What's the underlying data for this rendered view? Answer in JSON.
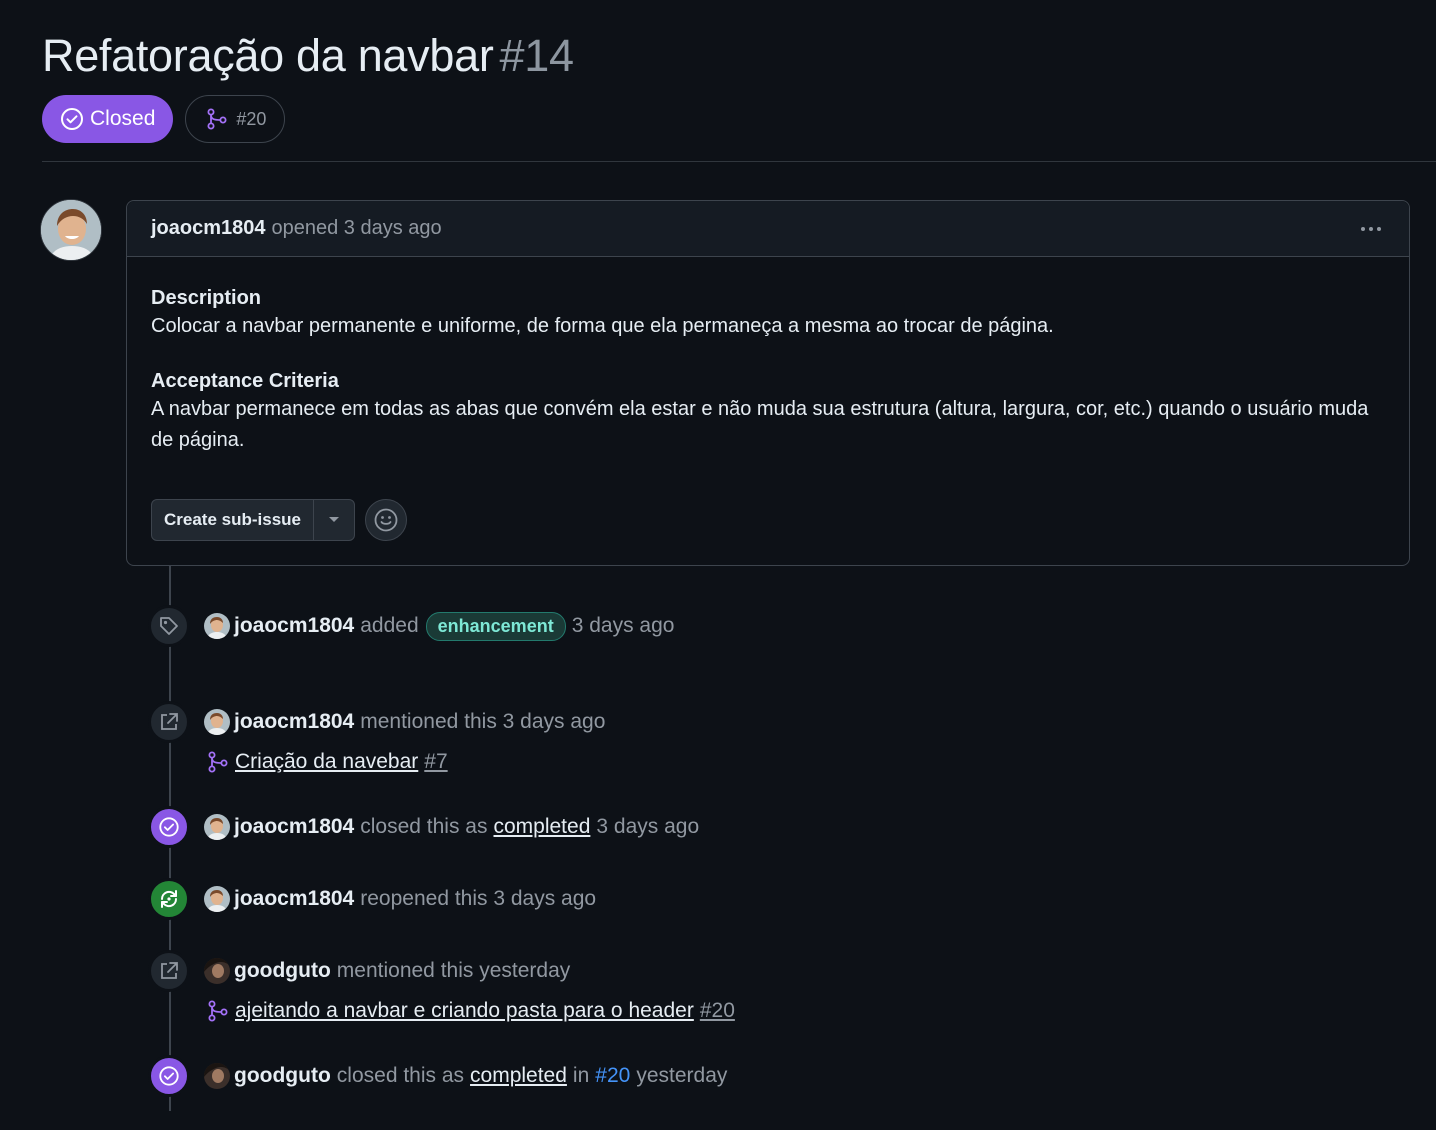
{
  "issue": {
    "title": "Refatoração da navbar",
    "number": "#14",
    "state_label": "Closed",
    "linked_pr": "#20",
    "state_color": "#8957e5"
  },
  "comment": {
    "author": "joaocm1804",
    "meta": "opened 3 days ago",
    "sections": [
      {
        "heading": "Description",
        "text": "Colocar a navbar permanente e uniforme, de forma que ela permaneça a mesma ao trocar de página."
      },
      {
        "heading": "Acceptance Criteria",
        "text": "A navbar permanece em todas as abas que convém ela estar e não muda sua estrutura (altura, largura, cor, etc.) quando o usuário muda de página."
      }
    ],
    "create_sub_issue_label": "Create sub-issue"
  },
  "timeline": [
    {
      "icon": "tag-icon",
      "actor": "joaocm1804",
      "action": "added",
      "label": "enhancement",
      "time": "3 days ago"
    },
    {
      "icon": "cross-reference-icon",
      "actor": "joaocm1804",
      "action": "mentioned this 3 days ago",
      "ref_title": "Criação da navebar",
      "ref_num": "#7"
    },
    {
      "icon": "check-circle-icon",
      "actor": "joaocm1804",
      "action": "closed this as",
      "link": "completed",
      "time": "3 days ago"
    },
    {
      "icon": "reopen-icon",
      "actor": "joaocm1804",
      "action": "reopened this 3 days ago"
    },
    {
      "icon": "cross-reference-icon",
      "actor": "goodguto",
      "action": "mentioned this yesterday",
      "ref_title": "ajeitando a navbar e criando pasta para o header",
      "ref_num": "#20"
    },
    {
      "icon": "check-circle-icon",
      "actor": "goodguto",
      "action": "closed this as",
      "link": "completed",
      "in_word": "in",
      "pr": "#20",
      "time": "yesterday"
    }
  ]
}
